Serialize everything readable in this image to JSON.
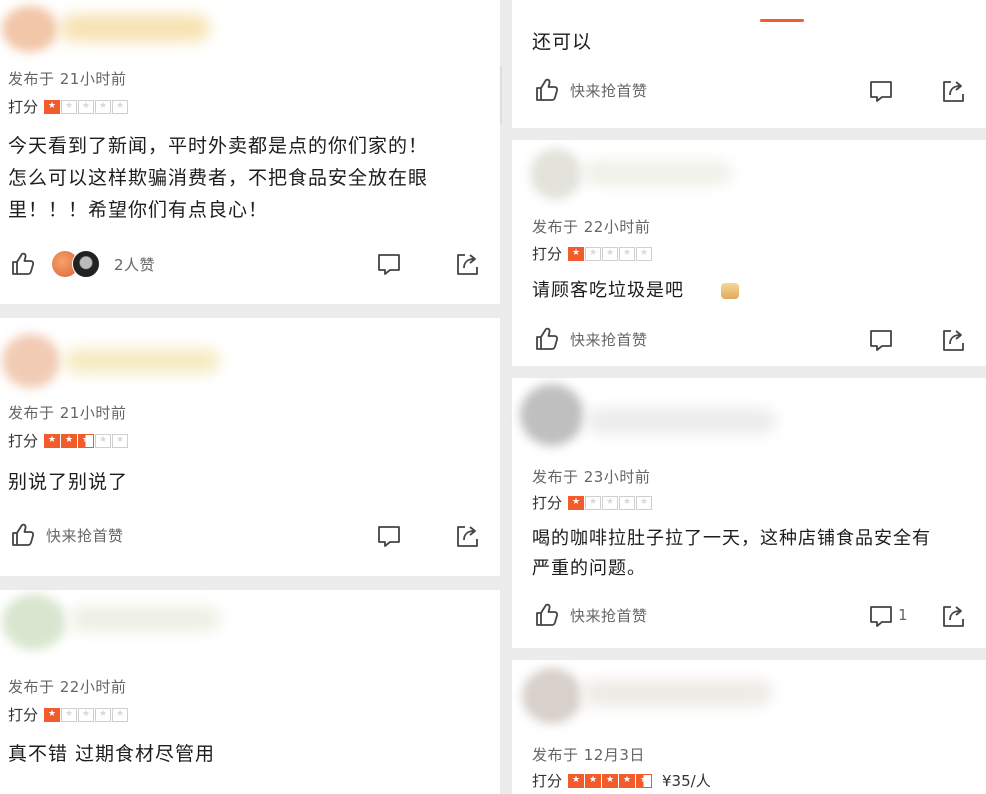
{
  "ui": {
    "colors": {
      "accent": "#f25c2b",
      "star_off": "#cfcfcf",
      "meta_text": "#666666",
      "background": "#ececec"
    },
    "icons": {
      "like": "thumbs-up-icon",
      "comment": "comment-bubble-icon",
      "share": "share-arrow-icon",
      "emoji": "thumbs-up-emoji"
    }
  },
  "reviews_left": [
    {
      "time": "发布于 21小时前",
      "rating_label": "打分",
      "stars": 1,
      "content_lines": [
        "今天看到了新闻，平时外卖都是点的你们家的！",
        "怎么可以这样欺骗消费者，不把食品安全放在眼",
        "里！！！希望你们有点良心！"
      ],
      "like_text": "2人赞"
    },
    {
      "time": "发布于 21小时前",
      "rating_label": "打分",
      "stars": 2.5,
      "content_lines": [
        "别说了别说了"
      ],
      "like_text": "快来抢首赞"
    },
    {
      "time": "发布于 22小时前",
      "rating_label": "打分",
      "stars": 1,
      "content_lines": [
        "真不错 过期食材尽管用"
      ]
    }
  ],
  "reviews_right": [
    {
      "content_lines": [
        "还可以"
      ],
      "like_text": "快来抢首赞"
    },
    {
      "time": "发布于 22小时前",
      "rating_label": "打分",
      "stars": 1,
      "content_lines": [
        "请顾客吃垃圾是吧"
      ],
      "like_text": "快来抢首赞"
    },
    {
      "time": "发布于 23小时前",
      "rating_label": "打分",
      "stars": 1,
      "content_lines": [
        "喝的咖啡拉肚子拉了一天，这种店铺食品安全有",
        "严重的问题。"
      ],
      "like_text": "快来抢首赞",
      "comment_count": "1"
    },
    {
      "time": "发布于 12月3日",
      "rating_label": "打分",
      "stars": 4.5,
      "price": "¥35/人"
    }
  ]
}
